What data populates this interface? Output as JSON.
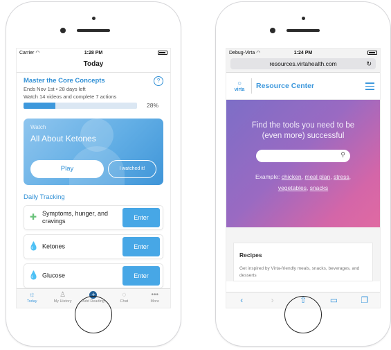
{
  "left": {
    "status": {
      "carrier": "Carrier",
      "time": "1:28 PM"
    },
    "nav_title": "Today",
    "challenge": {
      "title": "Master the Core Concepts",
      "ends": "Ends Nov 1st • 28 days left",
      "task": "Watch 14 videos and complete 7 actions",
      "progress_pct": 28,
      "progress_label": "28%",
      "help_glyph": "?"
    },
    "video": {
      "label": "Watch",
      "title": "All About Ketones",
      "play": "Play",
      "watched": "I watched it!"
    },
    "daily_tracking": {
      "heading": "Daily Tracking",
      "items": [
        {
          "label": "Symptoms, hunger, and cravings",
          "icon": "plus-outline-icon",
          "enter": "Enter"
        },
        {
          "label": "Ketones",
          "icon": "drop-icon",
          "enter": "Enter"
        },
        {
          "label": "Glucose",
          "icon": "drop-icon",
          "enter": "Enter"
        }
      ]
    },
    "tabs": [
      {
        "label": "Today",
        "icon": "sun-icon",
        "active": true
      },
      {
        "label": "My History",
        "icon": "person-icon",
        "active": false
      },
      {
        "label": "Add Reading",
        "icon": "add-circle-icon",
        "active": false
      },
      {
        "label": "Chat",
        "icon": "chat-icon",
        "active": false
      },
      {
        "label": "More",
        "icon": "more-icon",
        "active": false
      }
    ]
  },
  "right": {
    "status": {
      "carrier": "Debug-Virta",
      "time": "1:24 PM"
    },
    "url": "resources.virtahealth.com",
    "site": {
      "logo_text": "virta",
      "title": "Resource Center"
    },
    "hero": {
      "headline": "Find the tools you need to be (even more) successful",
      "example_prefix": "Example:",
      "links": [
        "chicken",
        "meal plan",
        "stress",
        "vegetables",
        "snacks"
      ]
    },
    "card": {
      "title": "Recipes",
      "description": "Get inspired by Virta-friendly meals, snacks, beverages, and desserts"
    }
  },
  "colors": {
    "accent": "#3d98dc",
    "hero_start": "#7d6ec7",
    "hero_end": "#e06aa2"
  }
}
